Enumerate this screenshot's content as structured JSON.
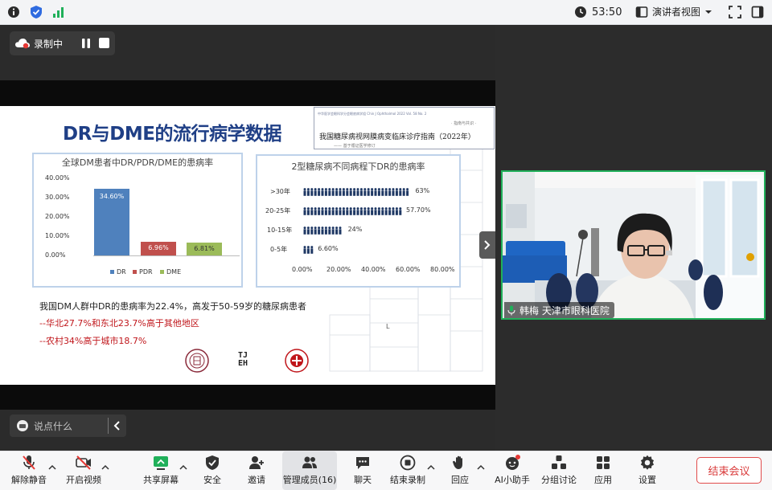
{
  "topbar": {
    "timer": "53:50",
    "view_label": "演讲者视图",
    "icons": [
      "info-icon",
      "shield-check-icon",
      "signal-icon",
      "clock-icon",
      "layout-icon",
      "chevron-down-icon",
      "fullscreen-icon",
      "window-icon"
    ]
  },
  "recording": {
    "label": "录制中",
    "icons": [
      "cloud-icon",
      "pause-icon",
      "stop-icon"
    ]
  },
  "slide": {
    "title": "DR与DME的流行病学数据",
    "guide_small": "中华医学会眼科学分会眼底病学组  Chin J Ophthalmol 2022  Vol. 58 No. 2",
    "guide_tag": "· 指南与共识 ·",
    "guide_title": "我国糖尿病视网膜病变临床诊疗指南（2022年）",
    "guide_by": "—— 基于循证医学修订",
    "stat_line1": "我国DM人群中DR的患病率为22.4%，高发于50-59岁的糖尿病患者",
    "stat_line2": "--华北27.7%和东北23.7%高于其他地区",
    "stat_line3": "--农村34%高于城市18.7%",
    "cursor_mark": "L",
    "logo_middle": "TJ EH"
  },
  "chart_data": [
    {
      "type": "bar",
      "title": "全球DM患者中DR/PDR/DME的患病率",
      "categories": [
        "DR",
        "PDR",
        "DME"
      ],
      "values": [
        34.6,
        6.96,
        6.81
      ],
      "value_labels": [
        "34.60%",
        "6.96%",
        "6.81%"
      ],
      "yticks": [
        "40.00%",
        "30.00%",
        "20.00%",
        "10.00%",
        "0.00%"
      ],
      "ylim": [
        0,
        40
      ],
      "colors": [
        "#4f81bd",
        "#c0504d",
        "#9bbb59"
      ],
      "legend": [
        "DR",
        "PDR",
        "DME"
      ],
      "legend_position": "bottom"
    },
    {
      "type": "bar",
      "title": "2型糖尿病不同病程下DR的患病率",
      "categories": [
        ">30年",
        "20-25年",
        "10-15年",
        "0-5年"
      ],
      "values": [
        63,
        57.7,
        24,
        6.6
      ],
      "value_labels": [
        "63%",
        "57.70%",
        "24%",
        "6.60%"
      ],
      "xticks": [
        "0.00%",
        "20.00%",
        "40.00%",
        "60.00%",
        "80.00%"
      ],
      "xlim": [
        0,
        80
      ],
      "color": "#1f3864"
    }
  ],
  "comment": {
    "placeholder": "说点什么"
  },
  "video": {
    "participant_name": "韩梅 天津市眼科医院"
  },
  "toolbar": {
    "items": [
      {
        "label": "解除静音",
        "icon": "mic-muted-icon"
      },
      {
        "label": "开启视频",
        "icon": "video-off-icon"
      },
      {
        "label": "共享屏幕",
        "icon": "share-screen-icon"
      },
      {
        "label": "安全",
        "icon": "shield-icon"
      },
      {
        "label": "邀请",
        "icon": "add-user-icon"
      },
      {
        "label": "管理成员(16)",
        "icon": "members-icon"
      },
      {
        "label": "聊天",
        "icon": "chat-icon"
      },
      {
        "label": "结束录制",
        "icon": "stop-record-icon"
      },
      {
        "label": "回应",
        "icon": "hand-icon"
      },
      {
        "label": "AI小助手",
        "icon": "ai-assistant-icon"
      },
      {
        "label": "分组讨论",
        "icon": "breakout-icon"
      },
      {
        "label": "应用",
        "icon": "apps-icon"
      },
      {
        "label": "设置",
        "icon": "gear-icon"
      }
    ],
    "end_meeting": "结束会议",
    "accent_color": "#20b05a",
    "end_color": "#d93a3a"
  }
}
